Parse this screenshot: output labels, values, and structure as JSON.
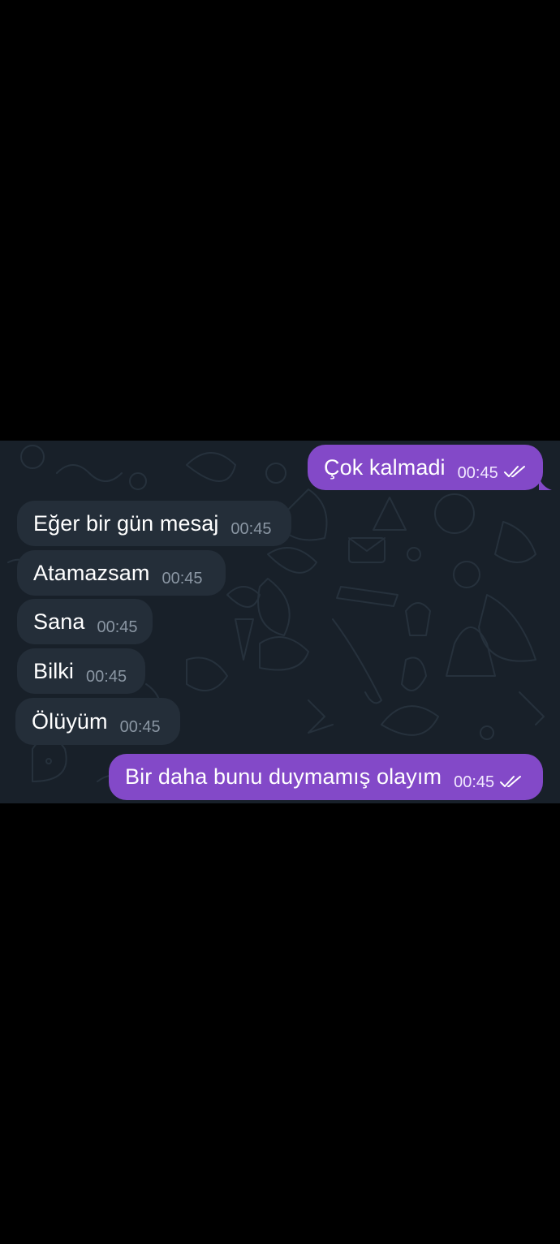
{
  "chat": {
    "messages": [
      {
        "direction": "out",
        "text": "Çok kalmadi",
        "time": "00:45",
        "status": "read"
      },
      {
        "direction": "in",
        "text": "Eğer bir gün mesaj",
        "time": "00:45"
      },
      {
        "direction": "in",
        "text": "Atamazsam",
        "time": "00:45"
      },
      {
        "direction": "in",
        "text": "Sana",
        "time": "00:45"
      },
      {
        "direction": "in",
        "text": "Bilki",
        "time": "00:45"
      },
      {
        "direction": "in",
        "text": "Ölüyüm",
        "time": "00:45"
      },
      {
        "direction": "out",
        "text": "Bir daha bunu duymamış olayım",
        "time": "00:45",
        "status": "read"
      }
    ]
  },
  "colors": {
    "outgoing_bubble": "#8349c8",
    "incoming_bubble": "#242e39",
    "chat_background": "#182029",
    "letterbox": "#000000"
  },
  "icons": {
    "read_receipt": "double-check-icon"
  }
}
